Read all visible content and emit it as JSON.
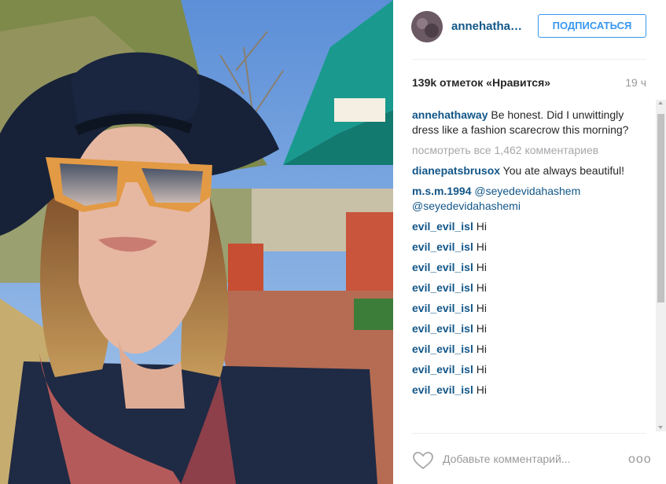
{
  "post": {
    "username": "annehatha…",
    "follow_label": "ПОДПИСАТЬСЯ",
    "likes": "139k отметок «Нравится»",
    "time": "19 ч",
    "caption_user": "annehathaway",
    "caption_text": " Be honest. Did I unwittingly dress like a fashion scarecrow this morning?",
    "view_all": "посмотреть все 1,462 комментариев",
    "comments": [
      {
        "user": "dianepatsbrusox",
        "text": " You ate always beautiful!"
      },
      {
        "user": "m.s.m.1994",
        "text": "@seyedevidahashem @seyedevidahashemi"
      },
      {
        "user": "evil_evil_isl",
        "text": " Hi"
      },
      {
        "user": "evil_evil_isl",
        "text": " Hi"
      },
      {
        "user": "evil_evil_isl",
        "text": " Hi"
      },
      {
        "user": "evil_evil_isl",
        "text": " Hi"
      },
      {
        "user": "evil_evil_isl",
        "text": " Hi"
      },
      {
        "user": "evil_evil_isl",
        "text": " Hi"
      },
      {
        "user": "evil_evil_isl",
        "text": " Hi"
      },
      {
        "user": "evil_evil_isl",
        "text": " Hi"
      },
      {
        "user": "evil_evil_isl",
        "text": " Hi"
      }
    ],
    "comment_placeholder": "Добавьте комментарий...",
    "more_label": "ooo"
  },
  "icons": {
    "heart": "heart-icon",
    "more": "more-options-icon"
  },
  "colors": {
    "link": "#125688",
    "follow": "#3897f0",
    "muted": "#999999"
  }
}
